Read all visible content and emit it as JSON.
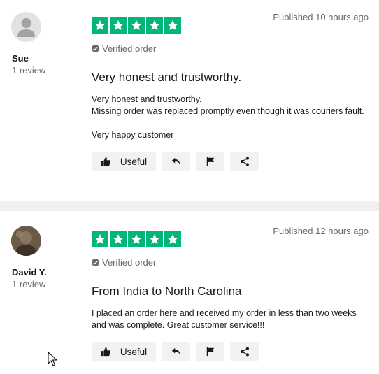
{
  "reviews": [
    {
      "name": "Sue",
      "review_count": "1 review",
      "published": "Published 10 hours ago",
      "verified": "Verified order",
      "title": "Very honest and trustworthy.",
      "body_lines": [
        "Very honest and trustworthy.",
        "Missing order was replaced promptly even though it was couriers fault.",
        "Very happy customer"
      ],
      "rating": 5,
      "useful_label": "Useful"
    },
    {
      "name": "David Y.",
      "review_count": "1 review",
      "published": "Published 12 hours ago",
      "verified": "Verified order",
      "title": "From India to North Carolina",
      "body_lines": [
        "I placed an order here and received my order in less than two weeks and was complete. Great customer service!!!"
      ],
      "rating": 5,
      "useful_label": "Useful"
    }
  ],
  "colors": {
    "star_green": "#00b67a",
    "muted_text": "#6a6a6a",
    "button_bg": "#f2f2f2"
  },
  "icons": {
    "star": "star-icon",
    "verified": "verified-check-icon",
    "useful": "thumbs-up-icon",
    "reply": "reply-icon",
    "report": "flag-icon",
    "share": "share-icon"
  }
}
